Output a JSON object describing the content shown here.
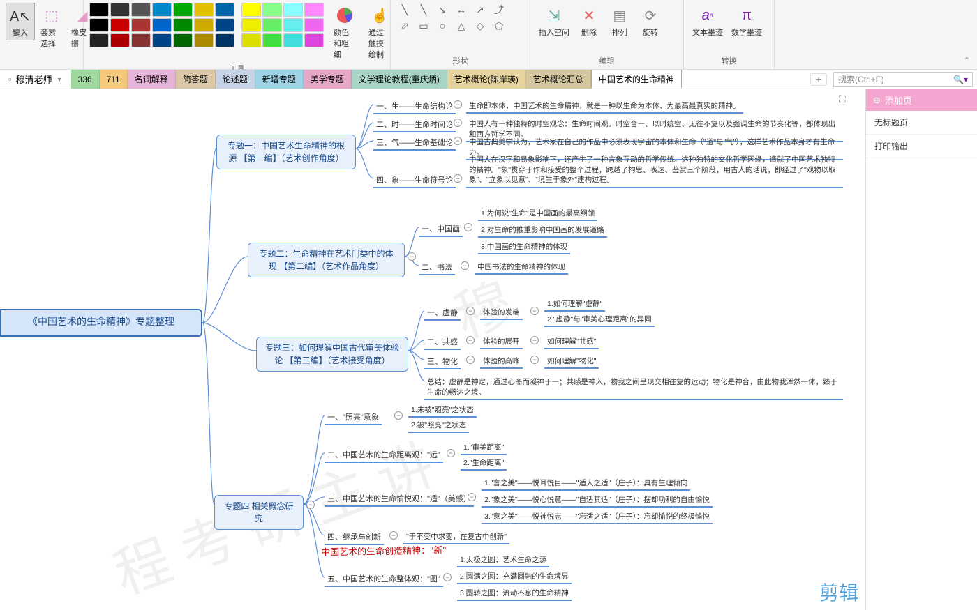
{
  "ribbon": {
    "groups": {
      "input": {
        "btn1": "键入",
        "btn2": "套索选择",
        "btn3": "橡皮擦"
      },
      "tools_label": "工具",
      "color_thickness": "颜色和粗细",
      "touch_draw": "通过触摸绘制",
      "shapes_label": "形状",
      "edit": {
        "insert_space": "插入空间",
        "delete": "删除",
        "arrange": "排列",
        "rotate": "旋转",
        "label": "编辑"
      },
      "convert": {
        "text_ink": "文本墨迹",
        "math_ink": "数学墨迹",
        "label": "转换"
      }
    }
  },
  "notebook": {
    "name": "穆清老师",
    "tabs": [
      {
        "label": "336",
        "color": "#9fd89f"
      },
      {
        "label": "711",
        "color": "#f5c97a"
      },
      {
        "label": "名词解释",
        "color": "#e6b3d9"
      },
      {
        "label": "简答题",
        "color": "#d9c7a8"
      },
      {
        "label": "论述题",
        "color": "#c7d4e6"
      },
      {
        "label": "新增专题",
        "color": "#9fd4e6"
      },
      {
        "label": "美学专题",
        "color": "#e6a8c7"
      },
      {
        "label": "文学理论教程(童庆炳)",
        "color": "#a8d4c7"
      },
      {
        "label": "艺术概论(陈岸瑛)",
        "color": "#e6d49f"
      },
      {
        "label": "艺术概论汇总",
        "color": "#d4c79f"
      },
      {
        "label": "中国艺术的生命精神",
        "color": "#ffffff"
      }
    ],
    "search_placeholder": "搜索(Ctrl+E)"
  },
  "side": {
    "add_page": "添加页",
    "items": [
      "无标题页",
      "打印输出"
    ]
  },
  "mindmap": {
    "root": "《中国艺术的生命精神》专题整理",
    "t1": {
      "title": "专题一：中国艺术生命精神的根源\n【第一编】（艺术创作角度）",
      "b1": "一、生——生命结构论",
      "b1d": "生命即本体，中国艺术的生命精神，就是一种以生命为本体、为最高最真实的精神。",
      "b2": "二、时——生命时间论",
      "b2d": "中国人有一种独特的时空观念：生命时间观。时空合一、以时统空、无往不复以及强调生命的节奏化等，都体现出和西方哲学不同。",
      "b3": "三、气——生命基础论",
      "b3d": "中国古典美学认为，艺术家在自己的作品中必须表现宇宙的本体和生命（\"道\"与\"气\"），这样艺术作品本身才有生命力。",
      "b4": "四、象——生命符号论",
      "b4d": "中国人在汉字和易象影响下，还产生了一种言象互动的哲学传统。这种独特的文化哲学因缘，造就了中国艺术独特的精神。\"象\"贯穿于作和接受的整个过程，跨越了构思、表达、鉴赏三个阶段，用古人的话说，即经过了\"观物以取象\"、\"立象以见意\"、\"境生于象外\"建构过程。"
    },
    "t2": {
      "title": "专题二：生命精神在艺术门类中的体现\n【第二编】（艺术作品角度）",
      "b1": "一、中国画",
      "b1_1": "1.为何说\"生命\"是中国画的最高纲领",
      "b1_2": "2.对生命的推重影响中国画的发展道路",
      "b1_3": "3.中国画的生命精神的体现",
      "b2": "二、书法",
      "b2d": "中国书法的生命精神的体现"
    },
    "t3": {
      "title": "专题三：如何理解中国古代审美体验论\n【第三编】（艺术接受角度）",
      "b1": "一、虚静",
      "b1d": "体验的发端",
      "b1_1": "1.如何理解\"虚静\"",
      "b1_2": "2.\"虚静\"与\"审美心理距离\"的异同",
      "b2": "二、共感",
      "b2d": "体验的展开",
      "b2_1": "如何理解\"共感\"",
      "b3": "三、物化",
      "b3d": "体验的高峰",
      "b3_1": "如何理解\"物化\"",
      "summary": "总结：虚静是神定，通过心斋而凝神于一；共感是神入，物我之间呈现交相往复的运动；物化是神合，由此物我浑然一体，臻于生命的畅达之境。"
    },
    "t4": {
      "title": "专题四 相关概念研究",
      "b1": "一、\"照亮\"意象",
      "b1_1": "1.未被\"照亮\"之状态",
      "b1_2": "2.被\"照亮\"之状态",
      "b2": "二、中国艺术的生命距离观：\"远\"",
      "b2_1": "1.\"审美距离\"",
      "b2_2": "2.\"生命距离\"",
      "b3": "三、中国艺术的生命愉悦观：\"适\"（美感）",
      "b3_1": "1.\"言之美\"——悦耳悦目——\"适人之适\"（庄子）：具有生理倾向",
      "b3_2": "2.\"象之美\"——悦心悦意——\"自适其适\"（庄子）：摆却功利的自由愉悦",
      "b3_3": "3.\"意之美\"——悦神悦志——\"忘适之适\"（庄子）：忘却愉悦的终极愉悦",
      "b4": "四、继承与创新",
      "b4d": "\"于不变中求变，在复古中创新\"",
      "red_note": "中国艺术的生命创造精神：\"新\"",
      "b5": "五、中国艺术的生命整体观：\"圆\"",
      "b5_1": "1.太极之圆：艺术生命之源",
      "b5_2": "2.圆满之圆：充满圆融的生命境界",
      "b5_3": "3.圆转之圆：流动不息的生命精神"
    }
  },
  "cut_label": "剪辑"
}
